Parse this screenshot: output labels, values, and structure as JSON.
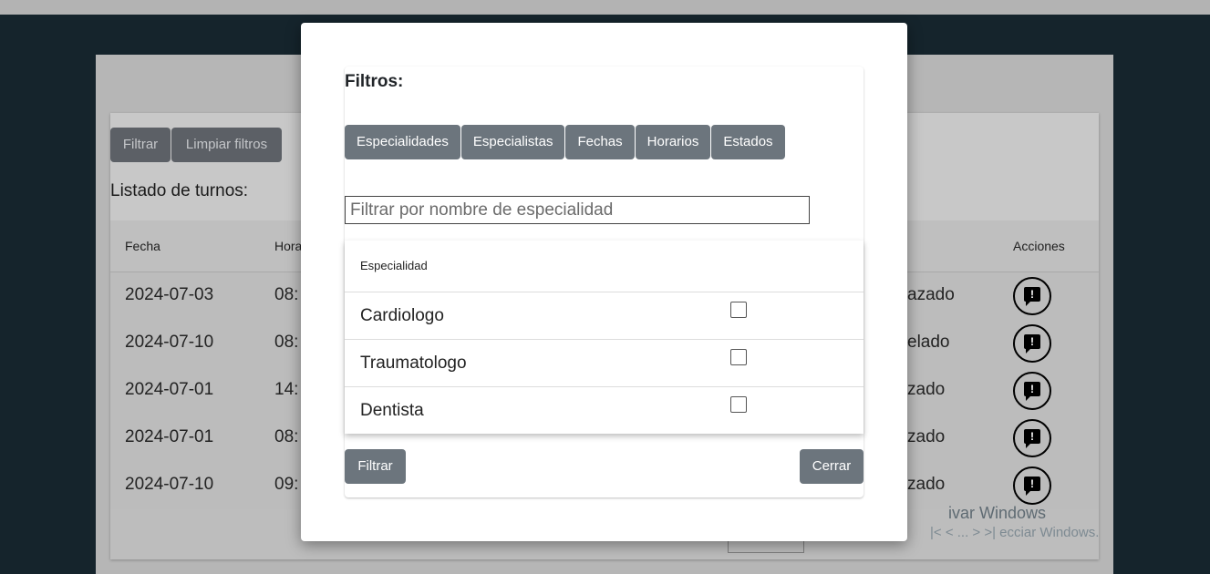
{
  "background": {
    "buttons": {
      "filter": "Filtrar",
      "clear_filters": "Limpiar filtros"
    },
    "title": "Listado de turnos:",
    "table": {
      "headers": {
        "date": "Fecha",
        "time": "Hora",
        "actions": "Acciones"
      },
      "rows": [
        {
          "date": "2024-07-03",
          "time": "08:",
          "status": "azado"
        },
        {
          "date": "2024-07-10",
          "time": "08:",
          "status": "elado"
        },
        {
          "date": "2024-07-01",
          "time": "14:",
          "status": "zado"
        },
        {
          "date": "2024-07-01",
          "time": "08:",
          "status": "zado"
        },
        {
          "date": "2024-07-10",
          "time": "09:",
          "status": "zado"
        }
      ],
      "action_icon": "report-comment-icon"
    },
    "watermark_line1": "ivar Windows",
    "watermark_line2": "|< < ... > >| ecciar Windows."
  },
  "modal": {
    "title": "Filtros:",
    "tabs": [
      "Especialidades",
      "Especialistas",
      "Fechas",
      "Horarios",
      "Estados"
    ],
    "search": {
      "placeholder": "Filtrar por nombre de especialidad",
      "value": ""
    },
    "specialty_table": {
      "header": "Especialidad",
      "rows": [
        {
          "name": "Cardiologo",
          "checked": false
        },
        {
          "name": "Traumatologo",
          "checked": false
        },
        {
          "name": "Dentista",
          "checked": false
        }
      ]
    },
    "buttons": {
      "filter": "Filtrar",
      "close": "Cerrar"
    }
  },
  "colors": {
    "button": "#6c757d",
    "backdrop": "#15242c"
  }
}
